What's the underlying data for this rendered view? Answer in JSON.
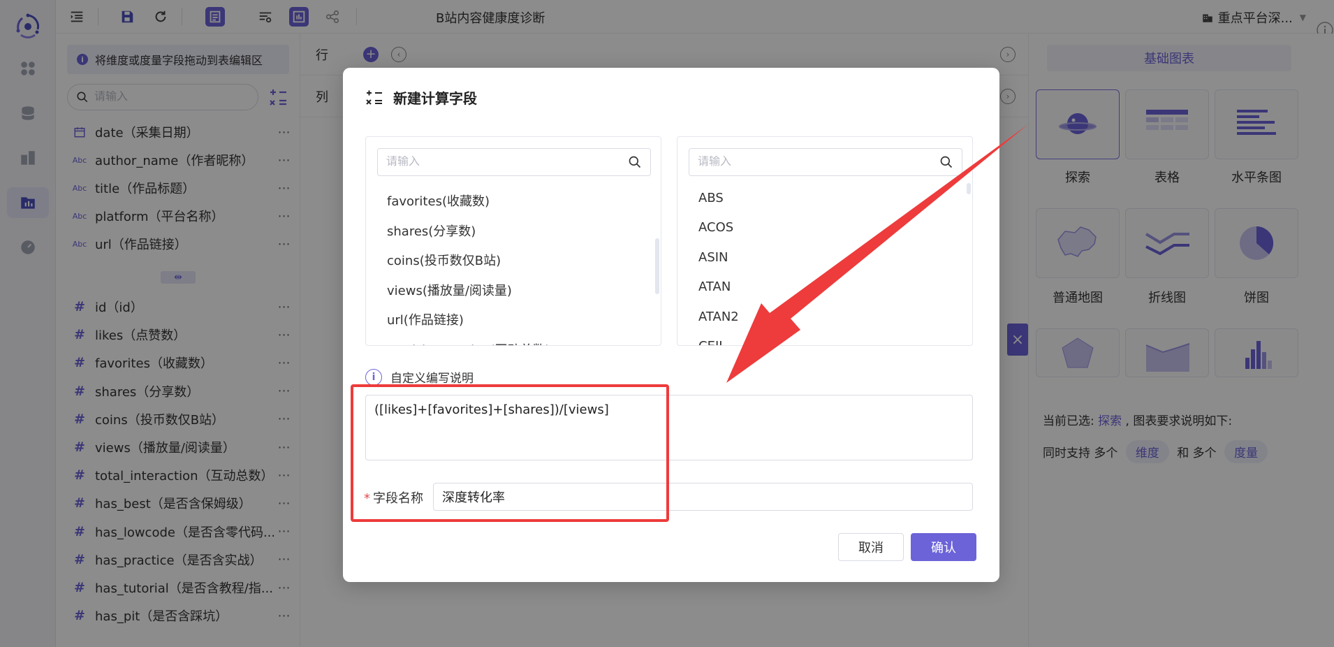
{
  "topbar": {
    "doc_title": "B站内容健康度诊断",
    "project_name": "重点平台深...",
    "icons": [
      "list-indent-icon",
      "save-icon",
      "refresh-icon",
      "table-view-icon",
      "filter-settings-icon",
      "chart-view-icon",
      "share-icon"
    ]
  },
  "rail": {
    "items": [
      "logo-icon",
      "apps-icon",
      "database-icon",
      "dashboard-icon",
      "report-icon",
      "gauge-icon"
    ]
  },
  "field_panel": {
    "hint": "将维度或度量字段拖动到表编辑区",
    "search_placeholder": "请输入",
    "dimensions": [
      {
        "type": "date",
        "name": "date（采集日期）"
      },
      {
        "type": "Abc",
        "name": "author_name（作者昵称）"
      },
      {
        "type": "Abc",
        "name": "title（作品标题）"
      },
      {
        "type": "Abc",
        "name": "platform（平台名称）"
      },
      {
        "type": "Abc",
        "name": "url（作品链接）"
      }
    ],
    "measures": [
      {
        "type": "#",
        "name": "id（id）"
      },
      {
        "type": "#",
        "name": "likes（点赞数）"
      },
      {
        "type": "#",
        "name": "favorites（收藏数）"
      },
      {
        "type": "#",
        "name": "shares（分享数）"
      },
      {
        "type": "#",
        "name": "coins（投币数仅B站）"
      },
      {
        "type": "#",
        "name": "views（播放量/阅读量）"
      },
      {
        "type": "#",
        "name": "total_interaction（互动总数）"
      },
      {
        "type": "#",
        "name": "has_best（是否含保姆级）"
      },
      {
        "type": "#",
        "name": "has_lowcode（是否含零代码..."
      },
      {
        "type": "#",
        "name": "has_practice（是否含实战）"
      },
      {
        "type": "#",
        "name": "has_tutorial（是否含教程/指..."
      },
      {
        "type": "#",
        "name": "has_pit（是否含踩坑）"
      }
    ],
    "more": "⋯"
  },
  "edit_area": {
    "row_label": "行",
    "col_label": "列"
  },
  "right_panel": {
    "tab": "基础图表",
    "charts": [
      {
        "label": "探索",
        "icon": "explore-chart-icon"
      },
      {
        "label": "表格",
        "icon": "table-chart-icon"
      },
      {
        "label": "水平条图",
        "icon": "horizontal-bar-chart-icon"
      },
      {
        "label": "普通地图",
        "icon": "map-chart-icon"
      },
      {
        "label": "折线图",
        "icon": "line-chart-icon"
      },
      {
        "label": "饼图",
        "icon": "pie-chart-icon"
      }
    ],
    "current_prefix": "当前已选:",
    "current_value": "探索",
    "current_suffix": ", 图表要求说明如下:",
    "support_prefix": "同时支持 多个",
    "pill_dim": "维度",
    "support_mid": "和 多个",
    "pill_measure": "度量"
  },
  "modal": {
    "title": "新建计算字段",
    "left_search_placeholder": "请输入",
    "right_search_placeholder": "请输入",
    "fields": [
      "favorites(收藏数)",
      "shares(分享数)",
      "coins(投币数仅B站)",
      "views(播放量/阅读量)",
      "url(作品链接)",
      "total_interaction(互动总数)"
    ],
    "functions": [
      "ABS",
      "ACOS",
      "ASIN",
      "ATAN",
      "ATAN2",
      "CEIL"
    ],
    "note": "自定义编写说明",
    "formula": "([likes]+[favorites]+[shares])/[views]",
    "field_name_label": "字段名称",
    "field_name_required": "*",
    "field_name_value": "深度转化率",
    "cancel": "取消",
    "confirm": "确认"
  },
  "colors": {
    "accent": "#6c63d9",
    "annotation": "#ee3b3b",
    "overlay": "rgba(0,0,0,0.45)"
  }
}
